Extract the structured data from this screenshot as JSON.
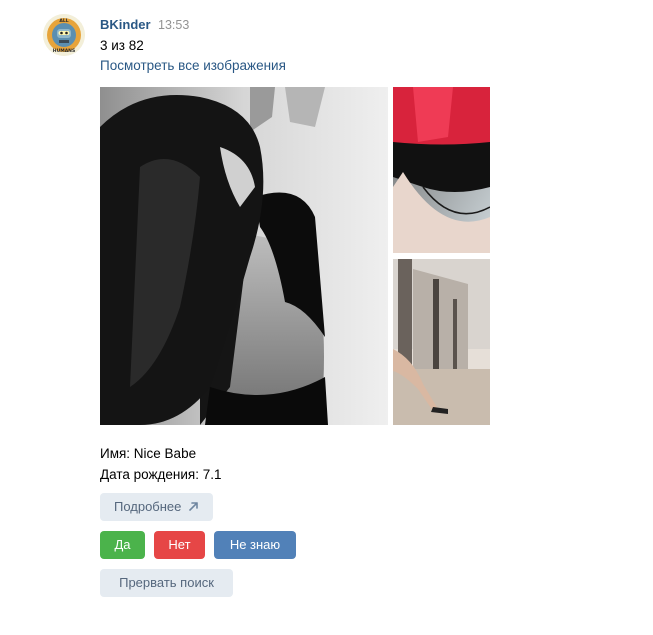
{
  "message": {
    "author": "BKinder",
    "time": "13:53",
    "counter": "3 из 82",
    "view_all_link": "Посмотреть все изображения",
    "avatar_icon": "kill-all-humans-robot-icon",
    "avatar_text_top": "KILL ALL",
    "avatar_text_bottom": "HUMANS",
    "profile": {
      "name_line": "Имя: Nice Babe",
      "birth_line": "Дата рождения: 7.1"
    }
  },
  "photos": {
    "main": "photo-main",
    "top_right": "photo-top-right",
    "bottom_right": "photo-bottom-right"
  },
  "buttons": {
    "details": "Подробнее",
    "details_icon": "arrow-up-right-icon",
    "yes": "Да",
    "no": "Нет",
    "unknown": "Не знаю",
    "stop": "Прервать поиск"
  },
  "colors": {
    "link": "#2a5885",
    "yes": "#4bb34b",
    "no": "#e64646",
    "unknown": "#5181b8",
    "light_button": "#e5ebf1"
  }
}
